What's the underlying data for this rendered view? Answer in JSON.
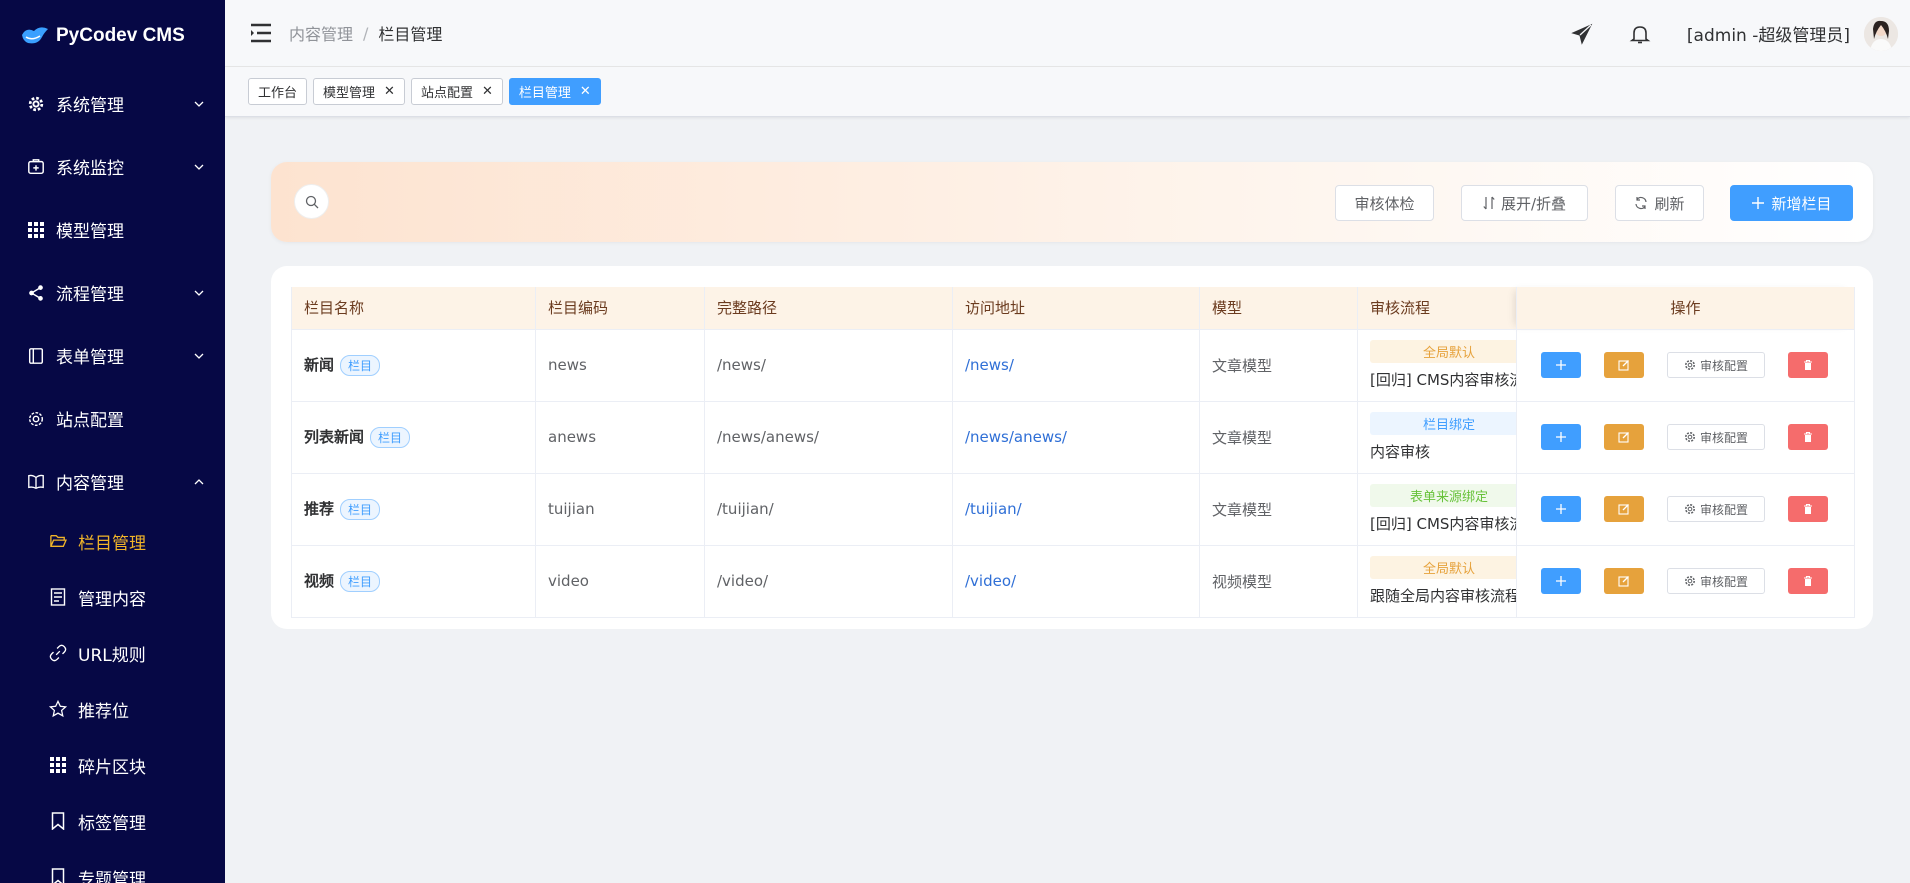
{
  "app": {
    "logo_text": "PyCodev CMS"
  },
  "sidebar": {
    "items": [
      {
        "label": "系统管理",
        "icon": "gear-icon",
        "expandable": true
      },
      {
        "label": "系统监控",
        "icon": "monitor-icon",
        "expandable": true
      },
      {
        "label": "模型管理",
        "icon": "grid-icon",
        "expandable": false
      },
      {
        "label": "流程管理",
        "icon": "share-icon",
        "expandable": true
      },
      {
        "label": "表单管理",
        "icon": "form-icon",
        "expandable": true
      },
      {
        "label": "站点配置",
        "icon": "settings-icon",
        "expandable": false
      },
      {
        "label": "内容管理",
        "icon": "book-icon",
        "expandable": true,
        "expanded": true
      }
    ],
    "sub_items": [
      {
        "label": "栏目管理",
        "icon": "folder-open-icon",
        "active": true
      },
      {
        "label": "管理内容",
        "icon": "document-icon"
      },
      {
        "label": "URL规则",
        "icon": "link-icon"
      },
      {
        "label": "推荐位",
        "icon": "star-icon"
      },
      {
        "label": "碎片区块",
        "icon": "grid-icon"
      },
      {
        "label": "标签管理",
        "icon": "bookmark-icon"
      },
      {
        "label": "专题管理",
        "icon": "bookmark-icon"
      }
    ]
  },
  "header": {
    "breadcrumb": [
      "内容管理",
      "栏目管理"
    ],
    "user": "[admin -超级管理员]"
  },
  "tabs": [
    {
      "label": "工作台",
      "closable": false,
      "active": false
    },
    {
      "label": "模型管理",
      "closable": true,
      "active": false
    },
    {
      "label": "站点配置",
      "closable": true,
      "active": false
    },
    {
      "label": "栏目管理",
      "closable": true,
      "active": true
    }
  ],
  "toolbar": {
    "audit_check": "审核体检",
    "expand_collapse": "展开/折叠",
    "refresh": "刷新",
    "add_column": "新增栏目"
  },
  "table": {
    "headers": [
      "栏目名称",
      "栏目编码",
      "完整路径",
      "访问地址",
      "模型",
      "审核流程",
      "操作"
    ],
    "badge": "栏目",
    "audit_config_label": "审核配置",
    "rows": [
      {
        "name": "新闻",
        "code": "news",
        "path": "/news/",
        "url": "/news/",
        "model": "文章模型",
        "flow_tag": "全局默认",
        "flow_tag_color": "orange",
        "flow": "[回归] CMS内容审核流程"
      },
      {
        "name": "列表新闻",
        "code": "anews",
        "path": "/news/anews/",
        "url": "/news/anews/",
        "model": "文章模型",
        "flow_tag": "栏目绑定",
        "flow_tag_color": "blue",
        "flow": "内容审核"
      },
      {
        "name": "推荐",
        "code": "tuijian",
        "path": "/tuijian/",
        "url": "/tuijian/",
        "model": "文章模型",
        "flow_tag": "表单来源绑定",
        "flow_tag_color": "green",
        "flow": "[回归] CMS内容审核流程"
      },
      {
        "name": "视频",
        "code": "video",
        "path": "/video/",
        "url": "/video/",
        "model": "视频模型",
        "flow_tag": "全局默认",
        "flow_tag_color": "orange",
        "flow": "跟随全局内容审核流程"
      }
    ]
  }
}
